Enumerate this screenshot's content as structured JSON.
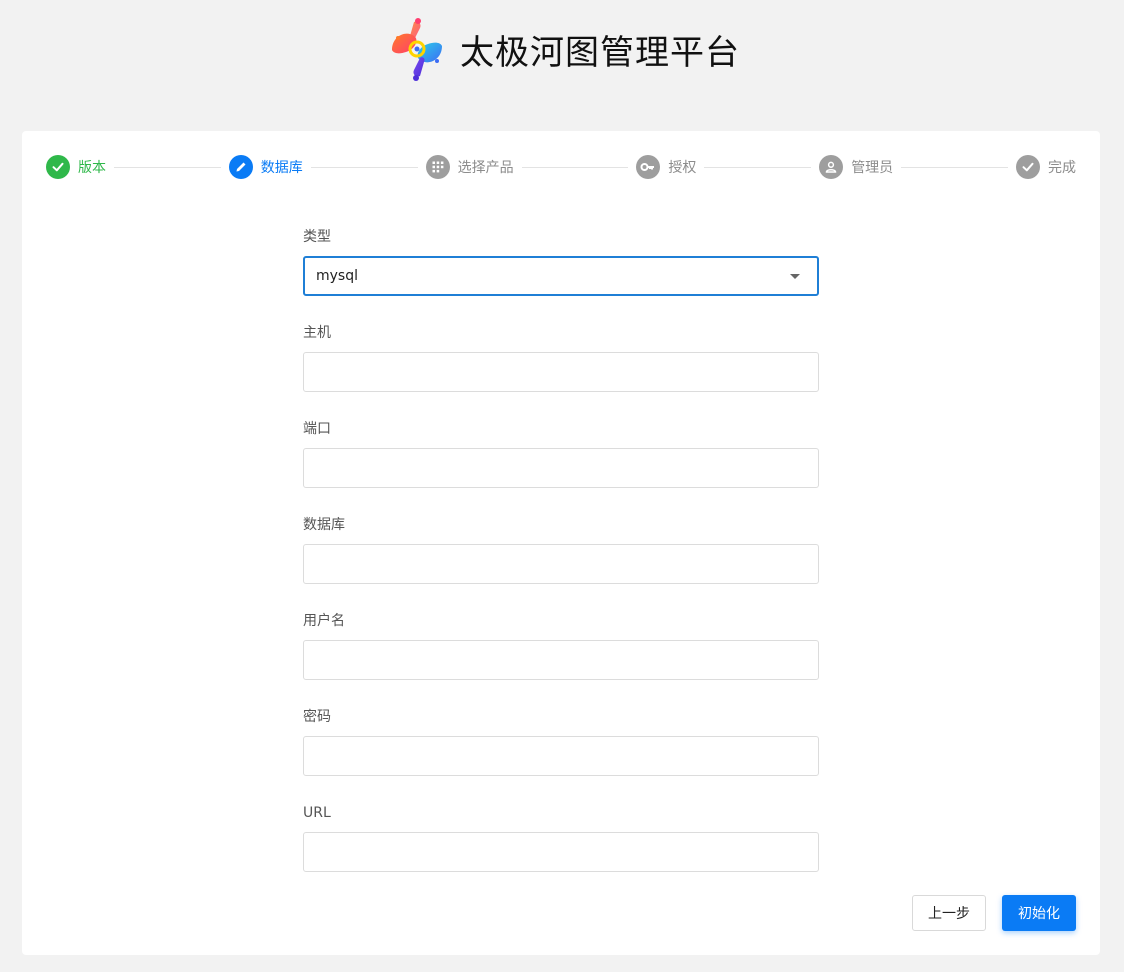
{
  "header": {
    "title": "太极河图管理平台",
    "logo_icon": "taiji-logo-icon"
  },
  "steps": [
    {
      "label": "版本",
      "status": "done",
      "icon": "check-icon"
    },
    {
      "label": "数据库",
      "status": "active",
      "icon": "pencil-icon"
    },
    {
      "label": "选择产品",
      "status": "pending",
      "icon": "grid-icon"
    },
    {
      "label": "授权",
      "status": "pending",
      "icon": "key-icon"
    },
    {
      "label": "管理员",
      "status": "pending",
      "icon": "user-icon"
    },
    {
      "label": "完成",
      "status": "pending",
      "icon": "check-icon"
    }
  ],
  "form": {
    "type": {
      "label": "类型",
      "value": "mysql"
    },
    "host": {
      "label": "主机",
      "value": ""
    },
    "port": {
      "label": "端口",
      "value": ""
    },
    "database": {
      "label": "数据库",
      "value": ""
    },
    "username": {
      "label": "用户名",
      "value": ""
    },
    "password": {
      "label": "密码",
      "value": ""
    },
    "url": {
      "label": "URL",
      "value": ""
    }
  },
  "buttons": {
    "prev": "上一步",
    "init": "初始化"
  },
  "colors": {
    "primary": "#0a7bf5",
    "success": "#2fb84a",
    "pending": "#9e9e9e"
  }
}
